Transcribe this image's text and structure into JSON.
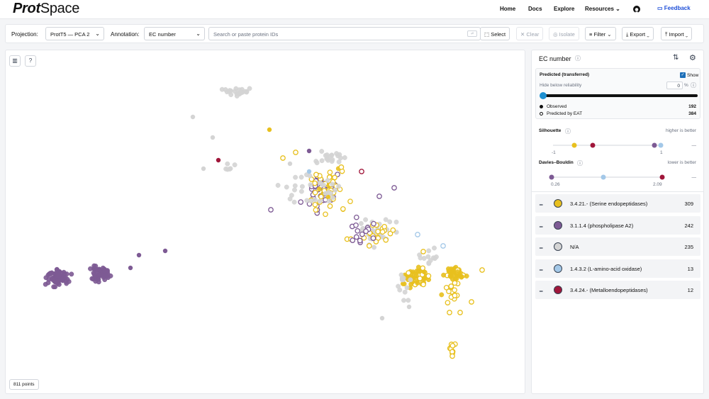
{
  "app": {
    "logo_a": "Prot",
    "logo_b": "Space"
  },
  "nav": {
    "home": "Home",
    "docs": "Docs",
    "explore": "Explore",
    "resources": "Resources",
    "feedback": "Feedback"
  },
  "toolbar": {
    "projection_label": "Projection:",
    "projection_value": "ProtT5 — PCA 2",
    "annotation_label": "Annotation:",
    "annotation_value": "EC number",
    "search_placeholder": "Search or paste protein IDs",
    "select": "Select",
    "clear": "Clear",
    "isolate": "Isolate",
    "filter": "Filter",
    "export": "Export",
    "import": "Import"
  },
  "plot": {
    "point_count": "811 points"
  },
  "panel": {
    "title": "EC number",
    "predicted_label": "Predicted (transferred)",
    "show_label": "Show",
    "show_checked": true,
    "hide_reliability_label": "Hide below reliability",
    "reliability_value": "0",
    "percent": "%",
    "observed_label": "Observed",
    "observed_count": "192",
    "predicted_by_label": "Predicted by EAT",
    "predicted_by_count": "384",
    "silhouette": {
      "title": "Silhouette",
      "hint": "higher is better",
      "min_label": "-1",
      "max_label": "1",
      "dash": "—"
    },
    "davies": {
      "title": "Davies–Bouldin",
      "hint": "lower is better",
      "min_label": "0.26",
      "max_label": "2.09",
      "dash": "—"
    }
  },
  "legend": [
    {
      "label": "3.4.21.- (Serine endopeptidases)",
      "count": "309",
      "color": "#e8c01e"
    },
    {
      "label": "3.1.1.4 (phospholipase A2)",
      "count": "242",
      "color": "#7d5a94"
    },
    {
      "label": "N/A",
      "count": "235",
      "color": "#d4d4d4"
    },
    {
      "label": "1.4.3.2 (L-amino-acid oxidase)",
      "count": "13",
      "color": "#a3c8e8"
    },
    {
      "label": "3.4.24.- (Metalloendopeptidases)",
      "count": "12",
      "color": "#a0163a"
    }
  ]
}
